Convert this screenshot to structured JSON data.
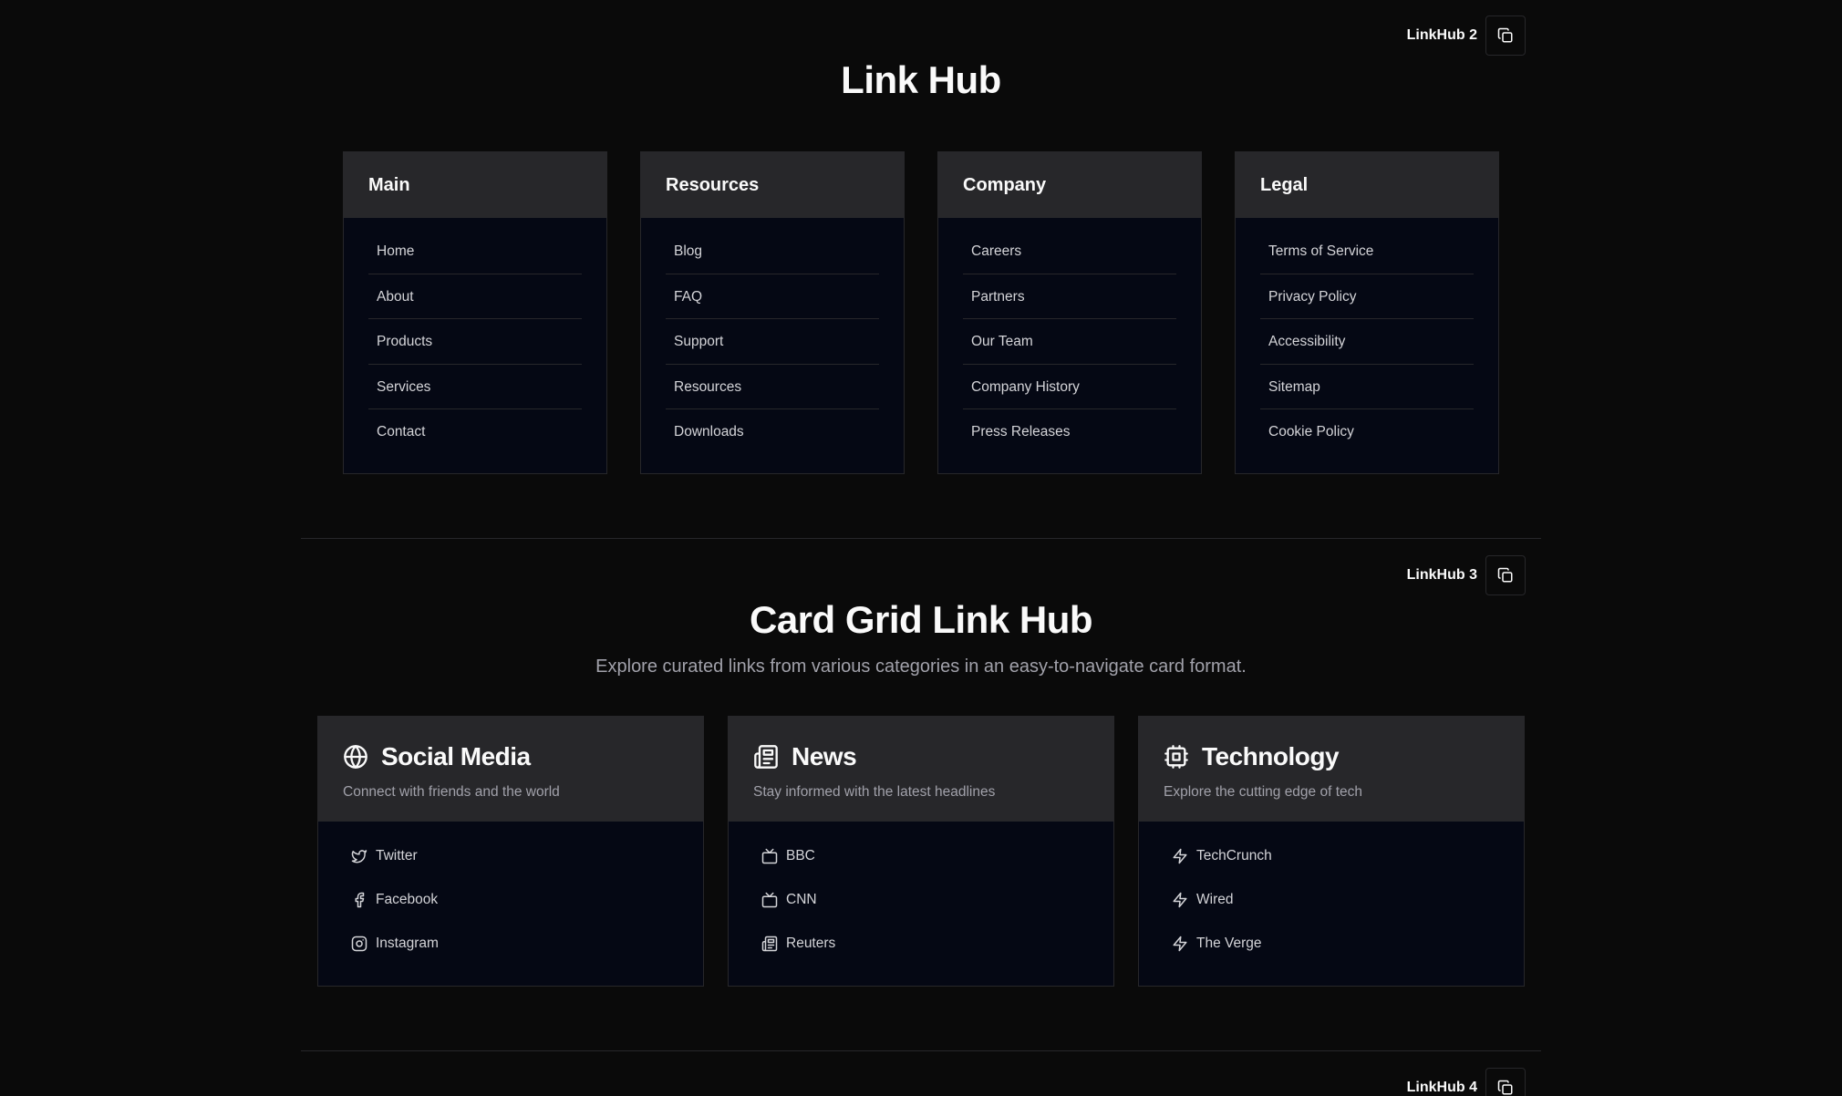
{
  "colors": {
    "background": "#0a0a0a",
    "panel_header": "#27272a",
    "panel_body": "#050814",
    "border": "#27272a",
    "text": "#fafafa",
    "muted": "#a1a1aa"
  },
  "section1": {
    "tag": "LinkHub 2",
    "title": "Link Hub",
    "columns": [
      {
        "heading": "Main",
        "links": [
          "Home",
          "About",
          "Products",
          "Services",
          "Contact"
        ]
      },
      {
        "heading": "Resources",
        "links": [
          "Blog",
          "FAQ",
          "Support",
          "Resources",
          "Downloads"
        ]
      },
      {
        "heading": "Company",
        "links": [
          "Careers",
          "Partners",
          "Our Team",
          "Company History",
          "Press Releases"
        ]
      },
      {
        "heading": "Legal",
        "links": [
          "Terms of Service",
          "Privacy Policy",
          "Accessibility",
          "Sitemap",
          "Cookie Policy"
        ]
      }
    ]
  },
  "section2": {
    "tag": "LinkHub 3",
    "title": "Card Grid Link Hub",
    "subtitle": "Explore curated links from various categories in an easy-to-navigate card format.",
    "cards": [
      {
        "title": "Social Media",
        "icon": "globe-icon",
        "description": "Connect with friends and the world",
        "links": [
          {
            "label": "Twitter",
            "icon": "twitter-icon"
          },
          {
            "label": "Facebook",
            "icon": "facebook-icon"
          },
          {
            "label": "Instagram",
            "icon": "instagram-icon"
          }
        ]
      },
      {
        "title": "News",
        "icon": "newspaper-icon",
        "description": "Stay informed with the latest headlines",
        "links": [
          {
            "label": "BBC",
            "icon": "tv-icon"
          },
          {
            "label": "CNN",
            "icon": "tv-icon"
          },
          {
            "label": "Reuters",
            "icon": "newspaper-icon"
          }
        ]
      },
      {
        "title": "Technology",
        "icon": "cpu-icon",
        "description": "Explore the cutting edge of tech",
        "links": [
          {
            "label": "TechCrunch",
            "icon": "zap-icon"
          },
          {
            "label": "Wired",
            "icon": "zap-icon"
          },
          {
            "label": "The Verge",
            "icon": "zap-icon"
          }
        ]
      }
    ]
  },
  "section3": {
    "tag": "LinkHub 4"
  }
}
